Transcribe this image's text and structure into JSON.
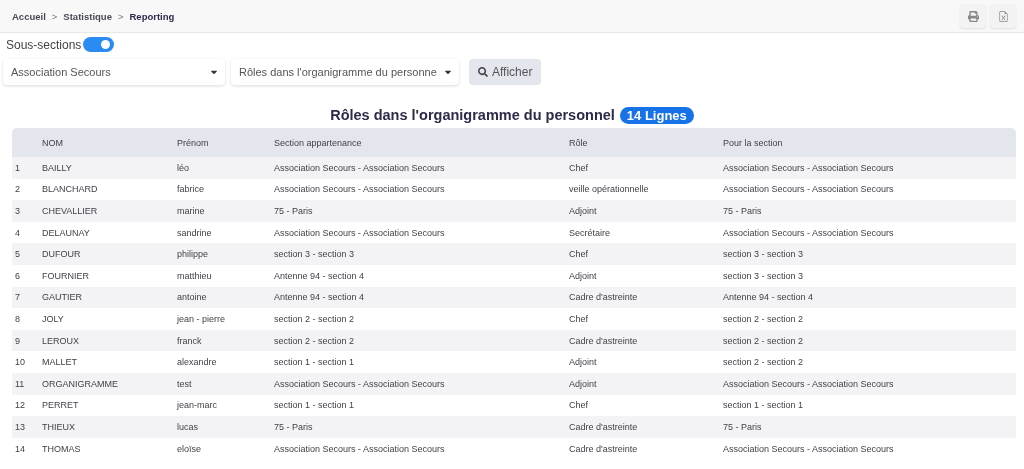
{
  "breadcrumb": [
    {
      "label": "Accueil",
      "current": false
    },
    {
      "label": "Statistique",
      "current": false
    },
    {
      "label": "Reporting",
      "current": true
    }
  ],
  "breadcrumb_separator": ">",
  "toolbar": [
    {
      "kind": "print"
    },
    {
      "kind": "excel"
    }
  ],
  "subsections": {
    "label": "Sous-sections",
    "on": true
  },
  "filters": [
    {
      "value": "Association Secours"
    },
    {
      "value": "Rôles dans l'organigramme du personne"
    }
  ],
  "show_button": {
    "label": "Afficher"
  },
  "report": {
    "title": "Rôles dans l'organigramme du personnel",
    "count": "14 Lignes"
  },
  "table": {
    "columns": [
      "",
      "NOM",
      "Prénom",
      "Section appartenance",
      "Rôle",
      "Pour la section"
    ],
    "rows": [
      [
        "1",
        "BAILLY",
        "léo",
        "Association Secours - Association Secours",
        "Chef",
        "Association Secours - Association Secours"
      ],
      [
        "2",
        "BLANCHARD",
        "fabrice",
        "Association Secours - Association Secours",
        "veille opérationnelle",
        "Association Secours - Association Secours"
      ],
      [
        "3",
        "CHEVALLIER",
        "marine",
        "75 - Paris",
        "Adjoint",
        "75 - Paris"
      ],
      [
        "4",
        "DELAUNAY",
        "sandrine",
        "Association Secours - Association Secours",
        "Secrétaire",
        "Association Secours - Association Secours"
      ],
      [
        "5",
        "DUFOUR",
        "philippe",
        "section 3 - section 3",
        "Chef",
        "section 3 - section 3"
      ],
      [
        "6",
        "FOURNIER",
        "matthieu",
        "Antenne 94 - section 4",
        "Adjoint",
        "section 3 - section 3"
      ],
      [
        "7",
        "GAUTIER",
        "antoine",
        "Antenne 94 - section 4",
        "Cadre d'astreinte",
        "Antenne 94 - section 4"
      ],
      [
        "8",
        "JOLY",
        "jean - pierre",
        "section 2 - section 2",
        "Chef",
        "section 2 - section 2"
      ],
      [
        "9",
        "LEROUX",
        "franck",
        "section 2 - section 2",
        "Cadre d'astreinte",
        "section 2 - section 2"
      ],
      [
        "10",
        "MALLET",
        "alexandre",
        "section 1 - section 1",
        "Adjoint",
        "section 2 - section 2"
      ],
      [
        "11",
        "ORGANIGRAMME",
        "test",
        "Association Secours - Association Secours",
        "Adjoint",
        "Association Secours - Association Secours"
      ],
      [
        "12",
        "PERRET",
        "jean-marc",
        "section 1 - section 1",
        "Chef",
        "section 1 - section 1"
      ],
      [
        "13",
        "THIEUX",
        "lucas",
        "75 - Paris",
        "Cadre d'astreinte",
        "75 - Paris"
      ],
      [
        "14",
        "THOMAS",
        "eloïse",
        "Association Secours - Association Secours",
        "Cadre d'astreinte",
        "Association Secours - Association Secours"
      ]
    ]
  }
}
